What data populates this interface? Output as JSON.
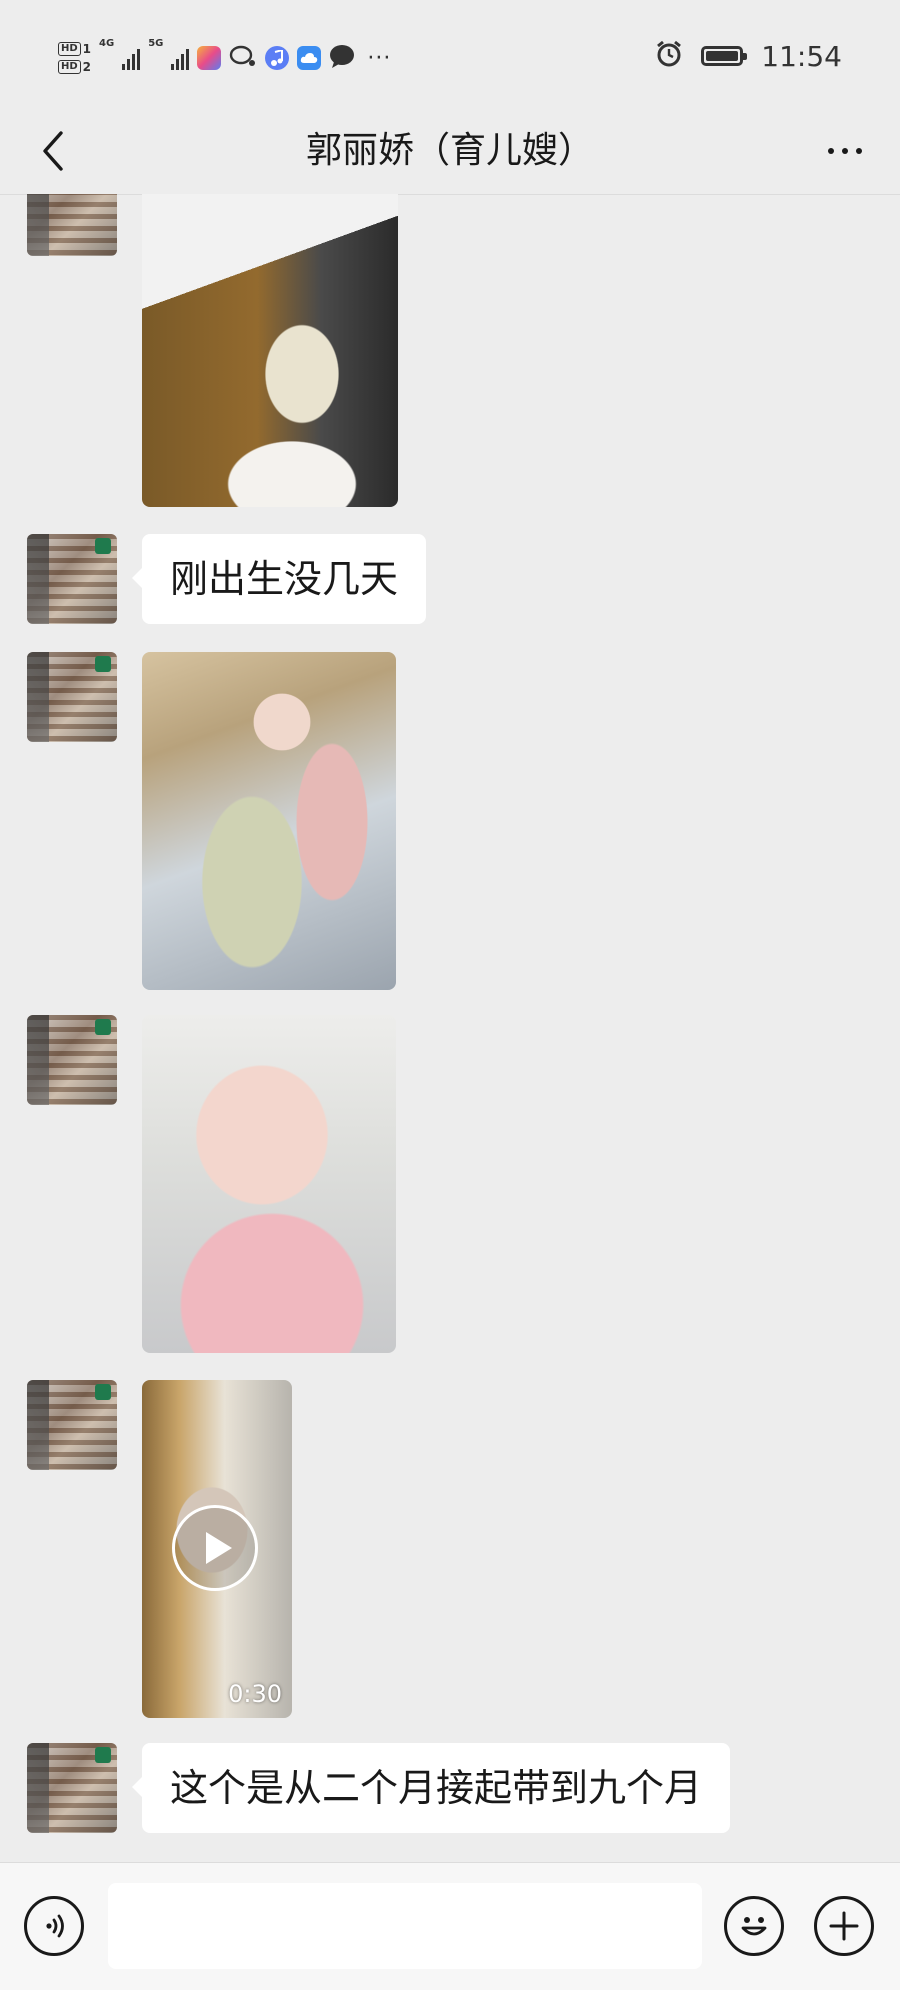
{
  "statusbar": {
    "sim1": "HD",
    "sim1_slot": "1",
    "sim2": "HD",
    "sim2_slot": "2",
    "network1": "4G",
    "network2": "5G",
    "overflow": "···",
    "time": "11:54",
    "icons": [
      "signal-4g-icon",
      "signal-5g-icon",
      "app-notification-icon",
      "wechat-moments-icon",
      "music-icon",
      "cloud-icon",
      "message-icon",
      "alarm-icon",
      "battery-icon"
    ]
  },
  "header": {
    "title": "郭丽娇（育儿嫂）",
    "back_icon": "chevron-left-icon",
    "more_icon": "more-dots-icon"
  },
  "messages": [
    {
      "type": "image",
      "sender": "contact"
    },
    {
      "type": "text",
      "sender": "contact",
      "text": "刚出生没几天"
    },
    {
      "type": "image",
      "sender": "contact"
    },
    {
      "type": "image",
      "sender": "contact"
    },
    {
      "type": "video",
      "sender": "contact",
      "duration": "0:30"
    },
    {
      "type": "text",
      "sender": "contact",
      "text": "这个是从二个月接起带到九个月"
    }
  ],
  "input_bar": {
    "value": "",
    "icons": [
      "voice-icon",
      "emoji-icon",
      "plus-icon"
    ]
  },
  "colors": {
    "background": "#ededed",
    "bubble": "#ffffff",
    "text": "#191919",
    "bar": "#f7f7f7"
  }
}
